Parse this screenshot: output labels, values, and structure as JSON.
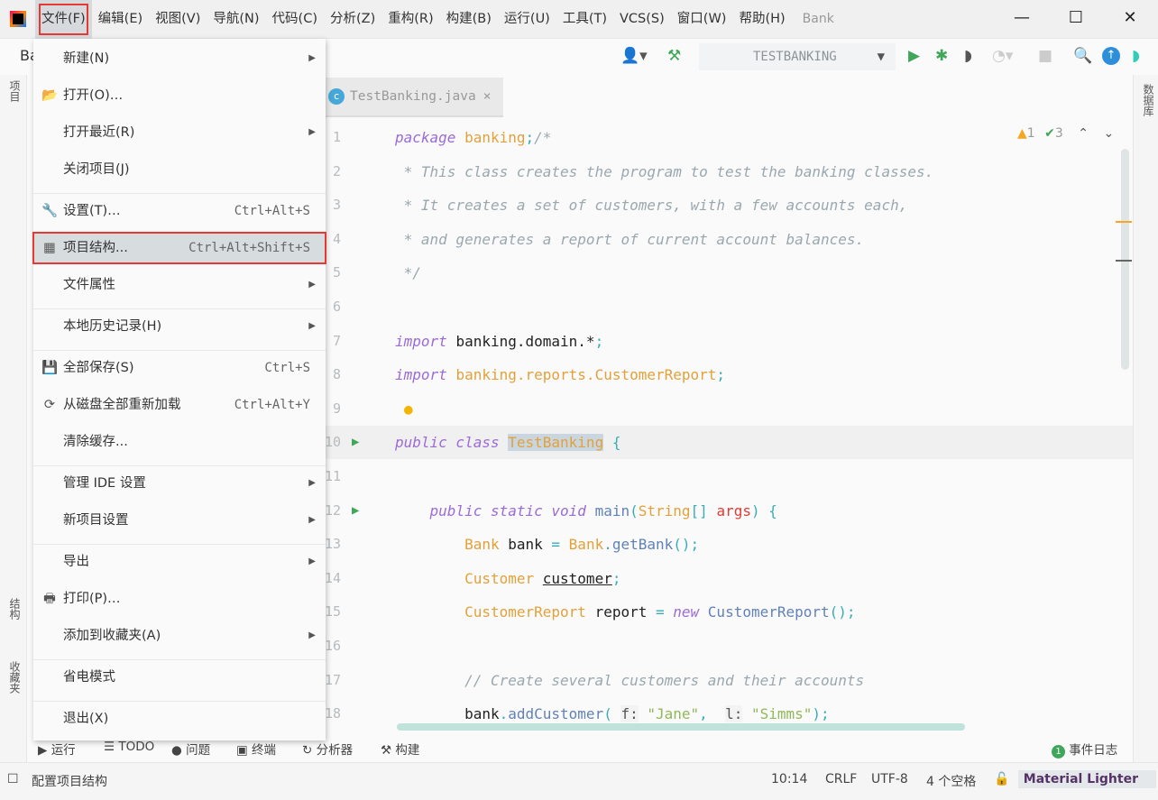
{
  "menubar": {
    "items": [
      "文件(F)",
      "编辑(E)",
      "视图(V)",
      "导航(N)",
      "代码(C)",
      "分析(Z)",
      "重构(R)",
      "构建(B)",
      "运行(U)",
      "工具(T)",
      "VCS(S)",
      "窗口(W)",
      "帮助(H)"
    ],
    "active_index": 0,
    "window_title": "Bank"
  },
  "window_controls": {
    "minimize": "—",
    "maximize": "☐",
    "close": "✕"
  },
  "toolbar": {
    "project_crumb": "Ba",
    "run_config": "TESTBANKING"
  },
  "left_strip": {
    "project": "项目",
    "structure": "结构",
    "favorites": "收藏夹"
  },
  "right_strip": {
    "database": "数据库"
  },
  "tab": {
    "label": "TestBanking.java",
    "close": "×"
  },
  "inspections": {
    "warnings": "1",
    "weak_warnings": "3"
  },
  "file_menu": {
    "items": [
      {
        "label": "新建(N)",
        "shortcut": "",
        "submenu": true,
        "icon": ""
      },
      {
        "label": "打开(O)…",
        "shortcut": "",
        "submenu": false,
        "icon": "folder-open"
      },
      {
        "label": "打开最近(R)",
        "shortcut": "",
        "submenu": true,
        "icon": ""
      },
      {
        "label": "关闭项目(J)",
        "shortcut": "",
        "submenu": false,
        "icon": ""
      },
      {
        "label": "设置(T)…",
        "shortcut": "Ctrl+Alt+S",
        "submenu": false,
        "icon": "wrench",
        "sep": true
      },
      {
        "label": "项目结构...",
        "shortcut": "Ctrl+Alt+Shift+S",
        "submenu": false,
        "icon": "project-structure",
        "selected": true
      },
      {
        "label": "文件属性",
        "shortcut": "",
        "submenu": true,
        "icon": ""
      },
      {
        "label": "本地历史记录(H)",
        "shortcut": "",
        "submenu": true,
        "icon": "",
        "sep": true
      },
      {
        "label": "全部保存(S)",
        "shortcut": "Ctrl+S",
        "submenu": false,
        "icon": "save",
        "sep": true
      },
      {
        "label": "从磁盘全部重新加载",
        "shortcut": "Ctrl+Alt+Y",
        "submenu": false,
        "icon": "reload"
      },
      {
        "label": "清除缓存...",
        "shortcut": "",
        "submenu": false,
        "icon": ""
      },
      {
        "label": "管理 IDE 设置",
        "shortcut": "",
        "submenu": true,
        "icon": "",
        "sep": true
      },
      {
        "label": "新项目设置",
        "shortcut": "",
        "submenu": true,
        "icon": ""
      },
      {
        "label": "导出",
        "shortcut": "",
        "submenu": true,
        "icon": "",
        "sep": true
      },
      {
        "label": "打印(P)…",
        "shortcut": "",
        "submenu": false,
        "icon": "print"
      },
      {
        "label": "添加到收藏夹(A)",
        "shortcut": "",
        "submenu": true,
        "icon": ""
      },
      {
        "label": "省电模式",
        "shortcut": "",
        "submenu": false,
        "icon": "",
        "sep": true
      },
      {
        "label": "退出(X)",
        "shortcut": "",
        "submenu": false,
        "icon": "",
        "sep": true
      }
    ]
  },
  "code": {
    "lines": [
      {
        "n": "1",
        "t": [
          [
            "kw",
            "package "
          ],
          [
            "ty",
            "banking"
          ],
          [
            "pu",
            ";"
          ],
          [
            "cm",
            "/*"
          ]
        ]
      },
      {
        "n": "2",
        "t": [
          [
            "cm",
            " * This class creates the program to test the banking classes."
          ]
        ]
      },
      {
        "n": "3",
        "t": [
          [
            "cm",
            " * It creates a set of customers, with a few accounts each,"
          ]
        ]
      },
      {
        "n": "4",
        "t": [
          [
            "cm",
            " * and generates a report of current account balances."
          ]
        ]
      },
      {
        "n": "5",
        "t": [
          [
            "cm",
            " */"
          ]
        ]
      },
      {
        "n": "6",
        "t": []
      },
      {
        "n": "7",
        "t": [
          [
            "kw",
            "import "
          ],
          [
            "id",
            "banking.domain.*"
          ],
          [
            "pu",
            ";"
          ]
        ]
      },
      {
        "n": "8",
        "t": [
          [
            "kw",
            "import "
          ],
          [
            "ty",
            "banking.reports.CustomerReport"
          ],
          [
            "pu",
            ";"
          ]
        ]
      },
      {
        "n": "9",
        "t": []
      },
      {
        "n": "10",
        "run": true,
        "cur": true,
        "t": [
          [
            "kw",
            "public class "
          ],
          [
            "ty hl",
            "TestBanking"
          ],
          [
            "pu",
            " {"
          ]
        ]
      },
      {
        "n": "11",
        "t": []
      },
      {
        "n": "12",
        "run": true,
        "t": [
          [
            "kw",
            "    public static void "
          ],
          [
            "fn",
            "main"
          ],
          [
            "pu",
            "("
          ],
          [
            "ty",
            "String"
          ],
          [
            "pu",
            "[] "
          ],
          [
            "pa",
            "args"
          ],
          [
            "pu",
            ") {"
          ]
        ]
      },
      {
        "n": "13",
        "t": [
          [
            "ty",
            "        Bank "
          ],
          [
            "id",
            "bank "
          ],
          [
            "pu",
            "= "
          ],
          [
            "ty",
            "Bank"
          ],
          [
            "pu",
            "."
          ],
          [
            "fn",
            "getBank"
          ],
          [
            "pu",
            "();"
          ]
        ]
      },
      {
        "n": "14",
        "t": [
          [
            "ty",
            "        Customer "
          ],
          [
            "id ul",
            "customer"
          ],
          [
            "pu",
            ";"
          ]
        ]
      },
      {
        "n": "15",
        "t": [
          [
            "ty",
            "        CustomerReport "
          ],
          [
            "id",
            "report "
          ],
          [
            "pu",
            "= "
          ],
          [
            "kw",
            "new "
          ],
          [
            "fn",
            "CustomerReport"
          ],
          [
            "pu",
            "();"
          ]
        ]
      },
      {
        "n": "16",
        "t": []
      },
      {
        "n": "17",
        "t": [
          [
            "cm",
            "        // Create several customers and their accounts"
          ]
        ]
      },
      {
        "n": "18",
        "t": [
          [
            "id",
            "        bank"
          ],
          [
            "pu",
            "."
          ],
          [
            "fn",
            "addCustomer"
          ],
          [
            "pu",
            "( "
          ],
          [
            "hint",
            "f:"
          ],
          [
            "st",
            " \"Jane\""
          ],
          [
            "pu",
            ",  "
          ],
          [
            "hint",
            "l:"
          ],
          [
            "st",
            " \"Simms\""
          ],
          [
            "pu",
            ");"
          ]
        ]
      }
    ]
  },
  "bottom_tools": {
    "run": "运行",
    "todo": "TODO",
    "problems": "问题",
    "terminal": "终端",
    "profiler": "分析器",
    "build": "构建",
    "event_log": "事件日志",
    "event_count": "1"
  },
  "status": {
    "message": "配置项目结构",
    "position": "10:14",
    "line_sep": "CRLF",
    "encoding": "UTF-8",
    "indent": "4 个空格",
    "theme": "Material Lighter"
  }
}
